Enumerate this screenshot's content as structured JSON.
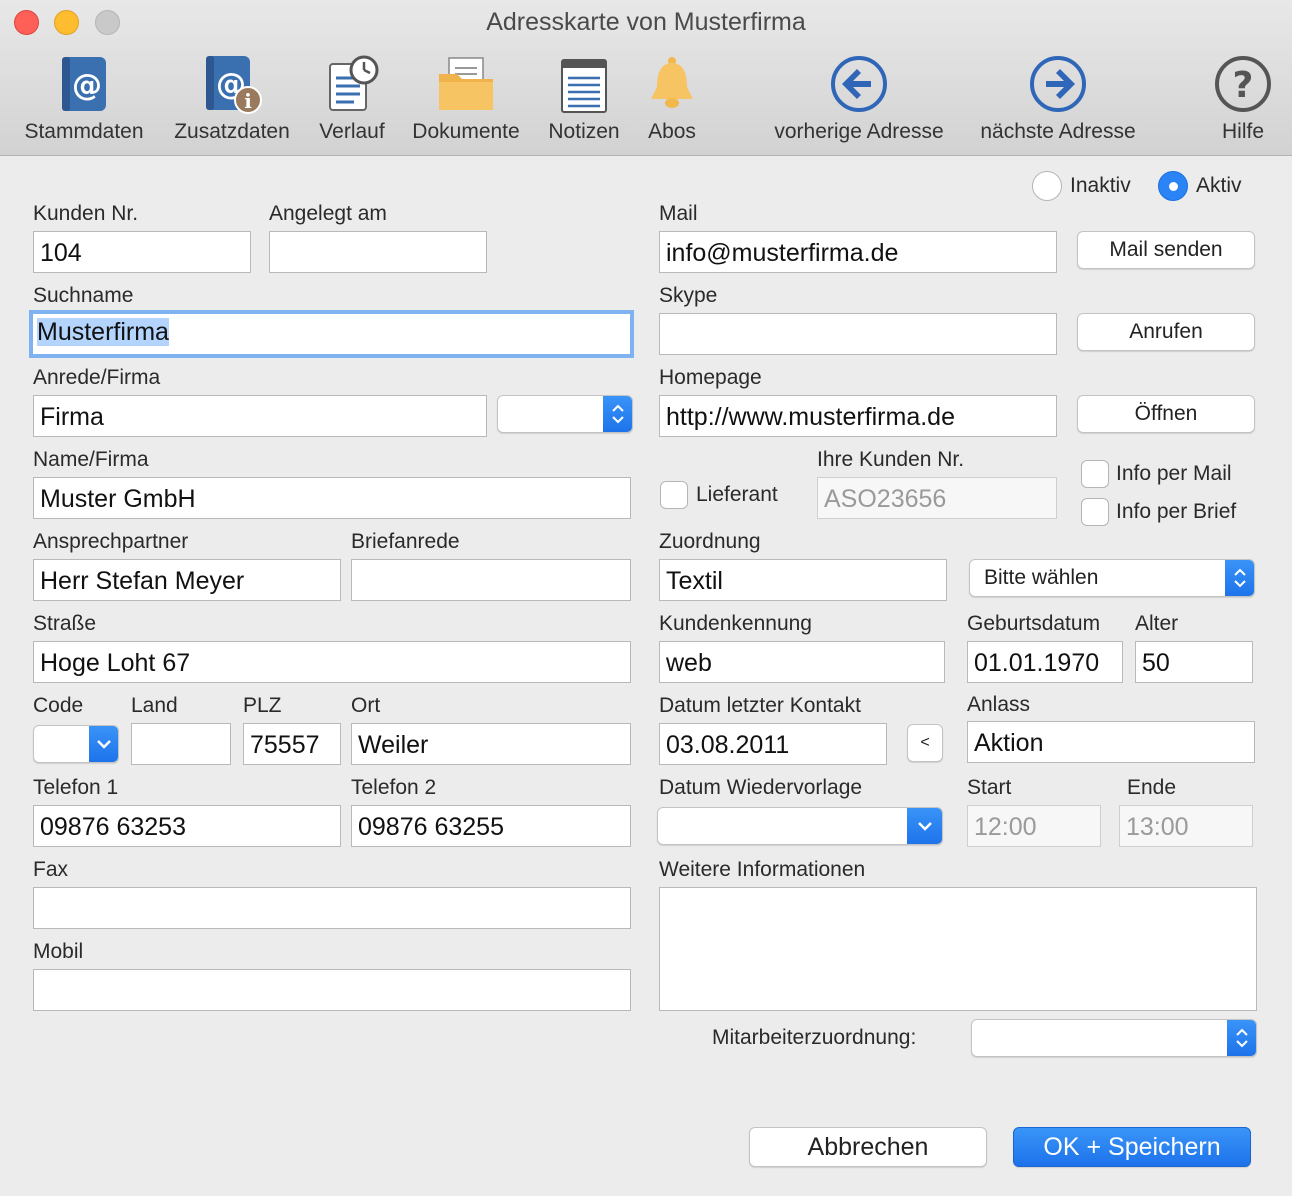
{
  "window": {
    "title": "Adresskarte von Musterfirma"
  },
  "toolbar": {
    "items": [
      {
        "label": "Stammdaten",
        "icon": "address-book-icon"
      },
      {
        "label": "Zusatzdaten",
        "icon": "address-book-info-icon"
      },
      {
        "label": "Verlauf",
        "icon": "history-clock-icon"
      },
      {
        "label": "Dokumente",
        "icon": "folder-icon"
      },
      {
        "label": "Notizen",
        "icon": "notepad-icon"
      },
      {
        "label": "Abos",
        "icon": "bell-icon"
      },
      {
        "label": "vorherige Adresse",
        "icon": "arrow-left-icon"
      },
      {
        "label": "nächste Adresse",
        "icon": "arrow-right-icon"
      },
      {
        "label": "Hilfe",
        "icon": "help-icon"
      }
    ]
  },
  "status": {
    "inactive_label": "Inaktiv",
    "active_label": "Aktiv",
    "selected": "Aktiv"
  },
  "left": {
    "kunden_nr": {
      "label": "Kunden Nr.",
      "value": "104"
    },
    "angelegt_am": {
      "label": "Angelegt am",
      "value": ""
    },
    "suchname": {
      "label": "Suchname",
      "value": "Musterfirma"
    },
    "anrede": {
      "label": "Anrede/Firma",
      "value": "Firma",
      "popup_value": ""
    },
    "name": {
      "label": "Name/Firma",
      "value": "Muster GmbH"
    },
    "ansprechpartner": {
      "label": "Ansprechpartner",
      "value": "Herr Stefan Meyer"
    },
    "briefanrede": {
      "label": "Briefanrede",
      "value": ""
    },
    "strasse": {
      "label": "Straße",
      "value": "Hoge Loht 67"
    },
    "code": {
      "label": "Code",
      "value": ""
    },
    "land": {
      "label": "Land",
      "value": ""
    },
    "plz": {
      "label": "PLZ",
      "value": "75557"
    },
    "ort": {
      "label": "Ort",
      "value": "Weiler"
    },
    "telefon1": {
      "label": "Telefon 1",
      "value": "09876 63253"
    },
    "telefon2": {
      "label": "Telefon 2",
      "value": "09876 63255"
    },
    "fax": {
      "label": "Fax",
      "value": ""
    },
    "mobil": {
      "label": "Mobil",
      "value": ""
    }
  },
  "right": {
    "mail": {
      "label": "Mail",
      "value": "info@musterfirma.de",
      "button": "Mail senden"
    },
    "skype": {
      "label": "Skype",
      "value": "",
      "button": "Anrufen"
    },
    "homepage": {
      "label": "Homepage",
      "value": "http://www.musterfirma.de",
      "button": "Öffnen"
    },
    "lieferant": {
      "label": "Lieferant",
      "checked": false
    },
    "ihre_kunden_nr": {
      "label": "Ihre Kunden Nr.",
      "value": "ASO23656"
    },
    "info_mail": {
      "label": "Info per Mail",
      "checked": false
    },
    "info_brief": {
      "label": "Info per Brief",
      "checked": false
    },
    "zuordnung": {
      "label": "Zuordnung",
      "value": "Textil",
      "popup_value": "Bitte wählen"
    },
    "kundenkennung": {
      "label": "Kundenkennung",
      "value": "web"
    },
    "geburtsdatum": {
      "label": "Geburtsdatum",
      "value": "01.01.1970"
    },
    "alter": {
      "label": "Alter",
      "value": "50"
    },
    "letzter_kontakt": {
      "label": "Datum letzter Kontakt",
      "value": "03.08.2011",
      "button": "<"
    },
    "anlass": {
      "label": "Anlass",
      "value": "Aktion"
    },
    "wiedervorlage": {
      "label": "Datum Wiedervorlage",
      "value": ""
    },
    "start": {
      "label": "Start",
      "value": "12:00"
    },
    "ende": {
      "label": "Ende",
      "value": "13:00"
    },
    "weitere_info": {
      "label": "Weitere Informationen",
      "value": ""
    },
    "mitarbeiter": {
      "label": "Mitarbeiterzuordnung:",
      "value": ""
    }
  },
  "footer": {
    "cancel_label": "Abbrechen",
    "ok_label": "OK + Speichern"
  },
  "colors": {
    "accent": "#1d72ea",
    "icon_blue": "#3a6fb0",
    "selection": "#b3d4fc"
  }
}
